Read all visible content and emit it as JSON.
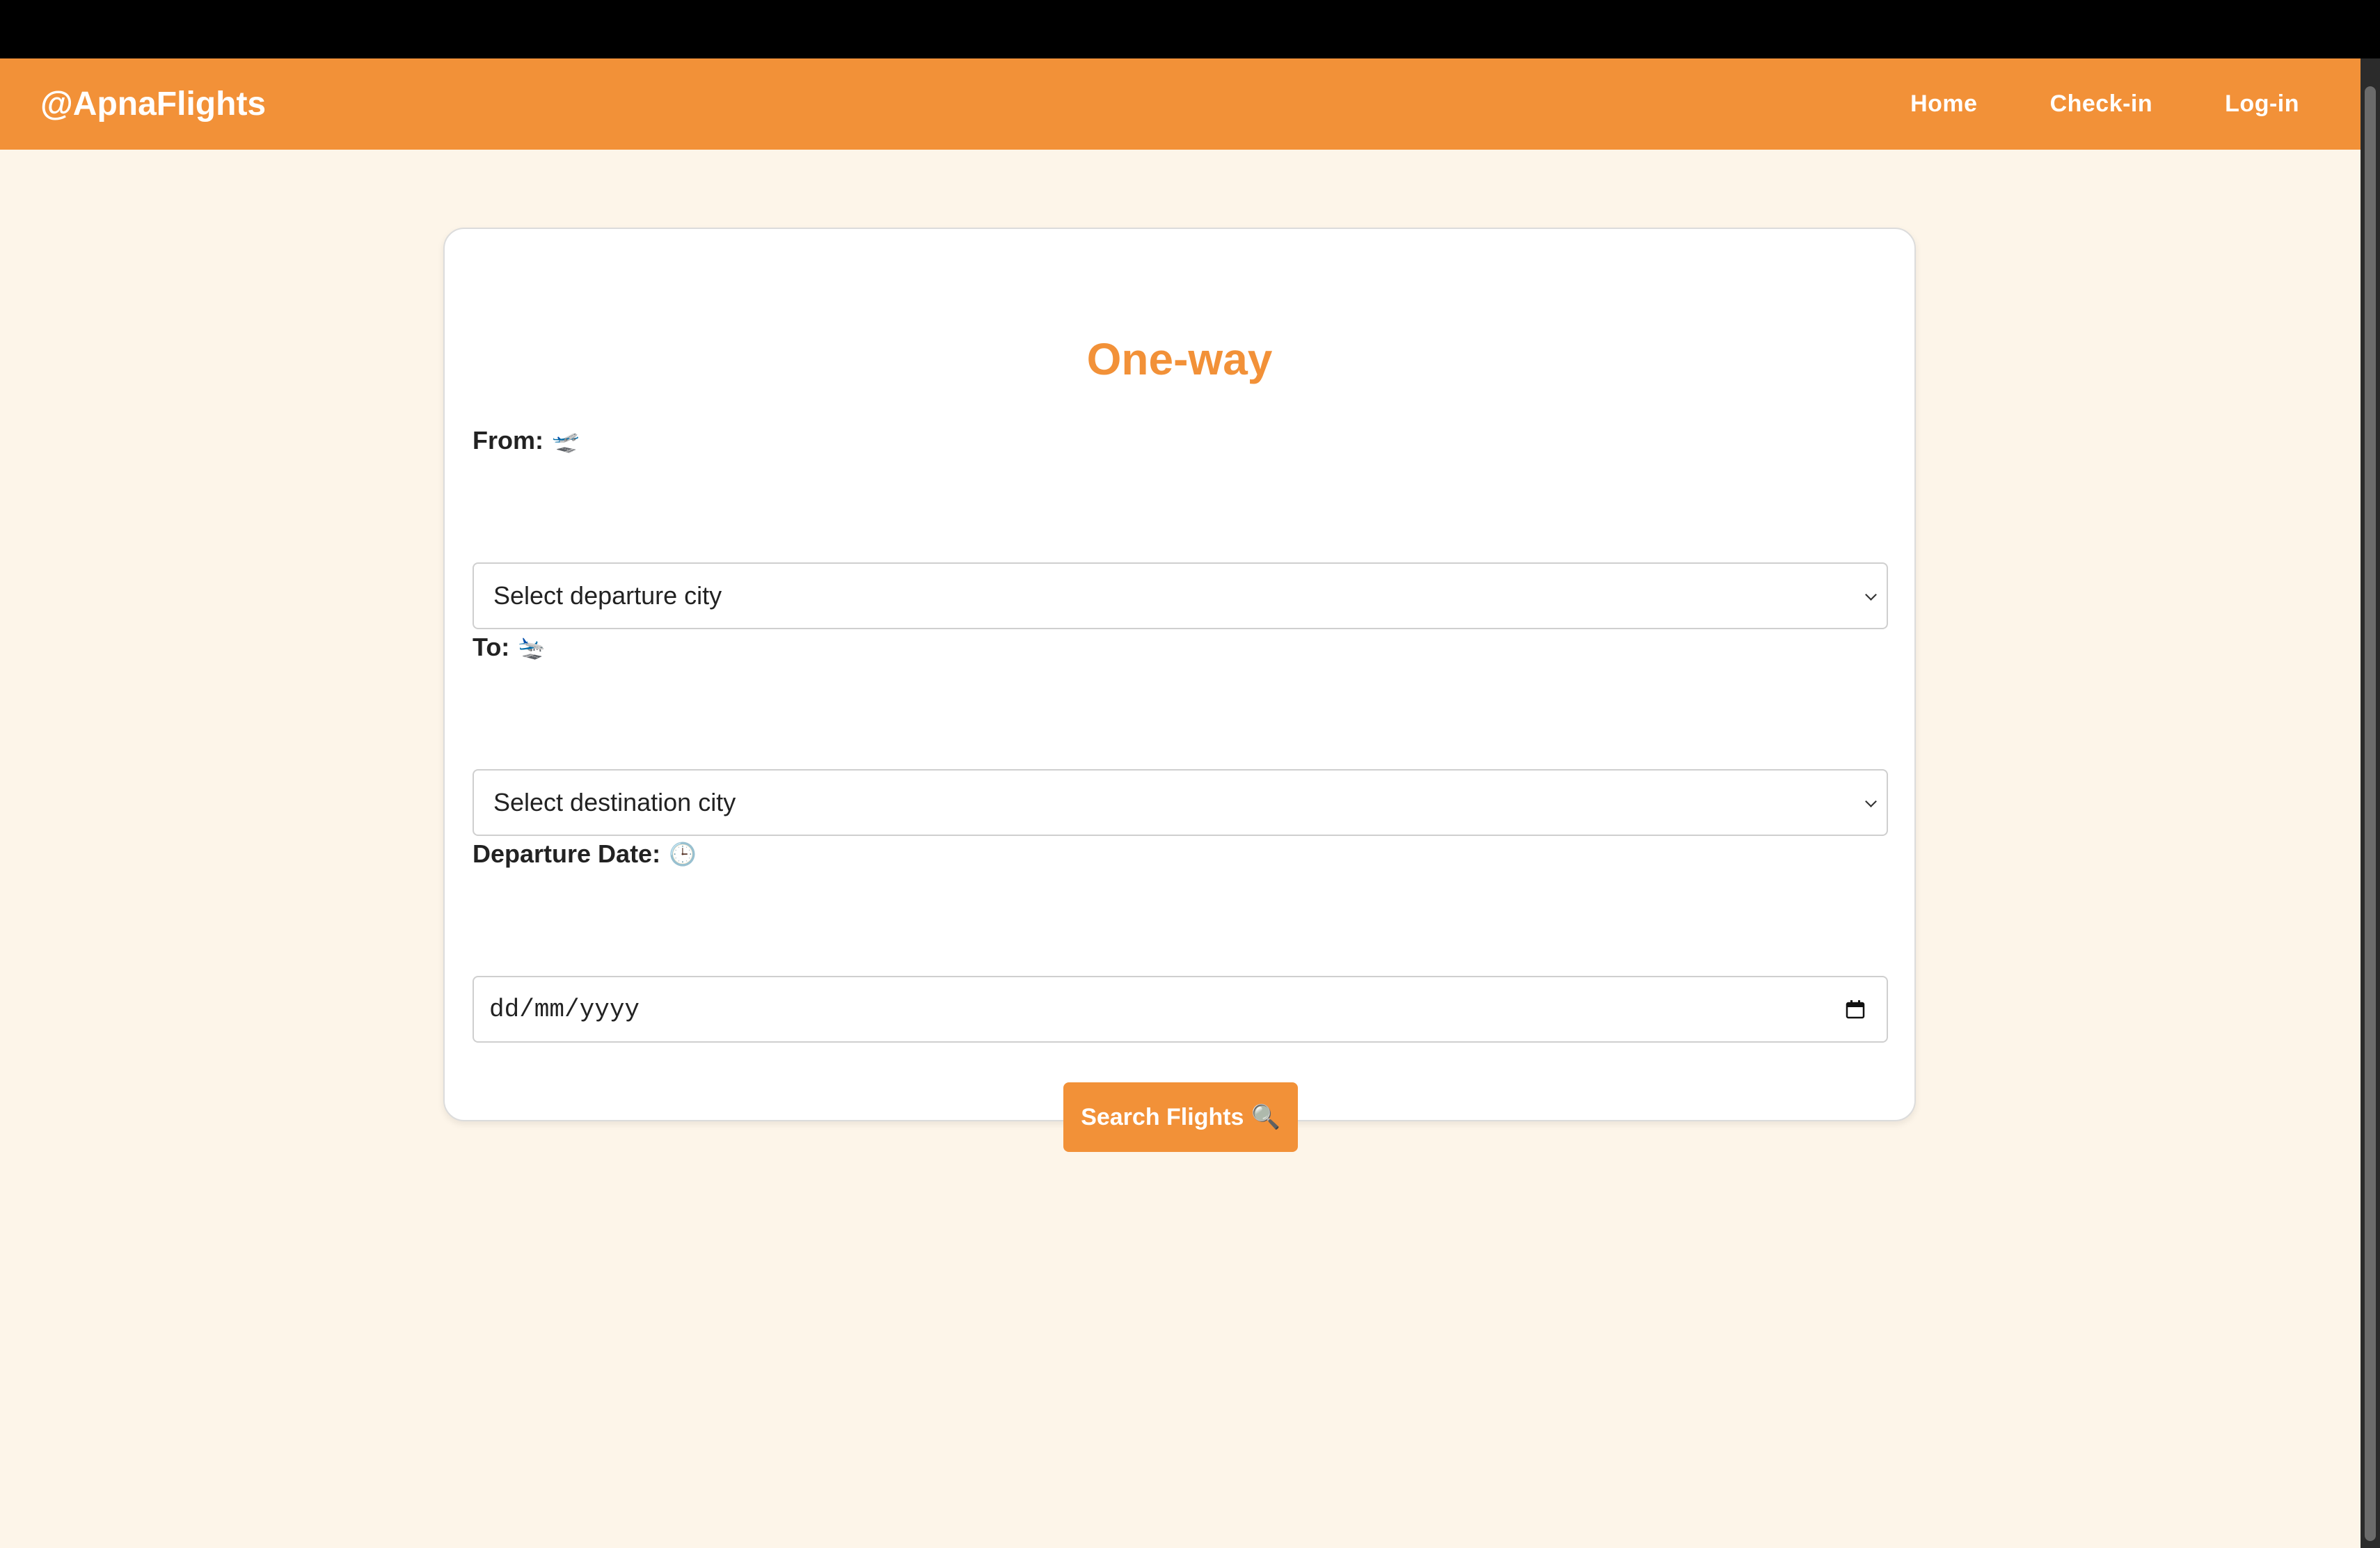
{
  "app": {
    "brand": "@ApnaFlights"
  },
  "nav": {
    "items": [
      {
        "label": "Home"
      },
      {
        "label": "Check-in"
      },
      {
        "label": "Log-in"
      }
    ]
  },
  "form": {
    "title": "One-way",
    "from": {
      "label": "From:",
      "icon": "airplane-departure-icon",
      "selected": "Select departure city"
    },
    "to": {
      "label": "To:",
      "icon": "airplane-arrival-icon",
      "selected": "Select destination city"
    },
    "date": {
      "label": "Departure Date:",
      "icon": "clock-icon",
      "placeholder": "dd/mm/yyyy"
    },
    "submit": {
      "label": "Search Flights",
      "icon": "magnifier-icon"
    }
  },
  "colors": {
    "accent": "#f29138",
    "background": "#fdf5e9",
    "card": "#ffffff"
  }
}
